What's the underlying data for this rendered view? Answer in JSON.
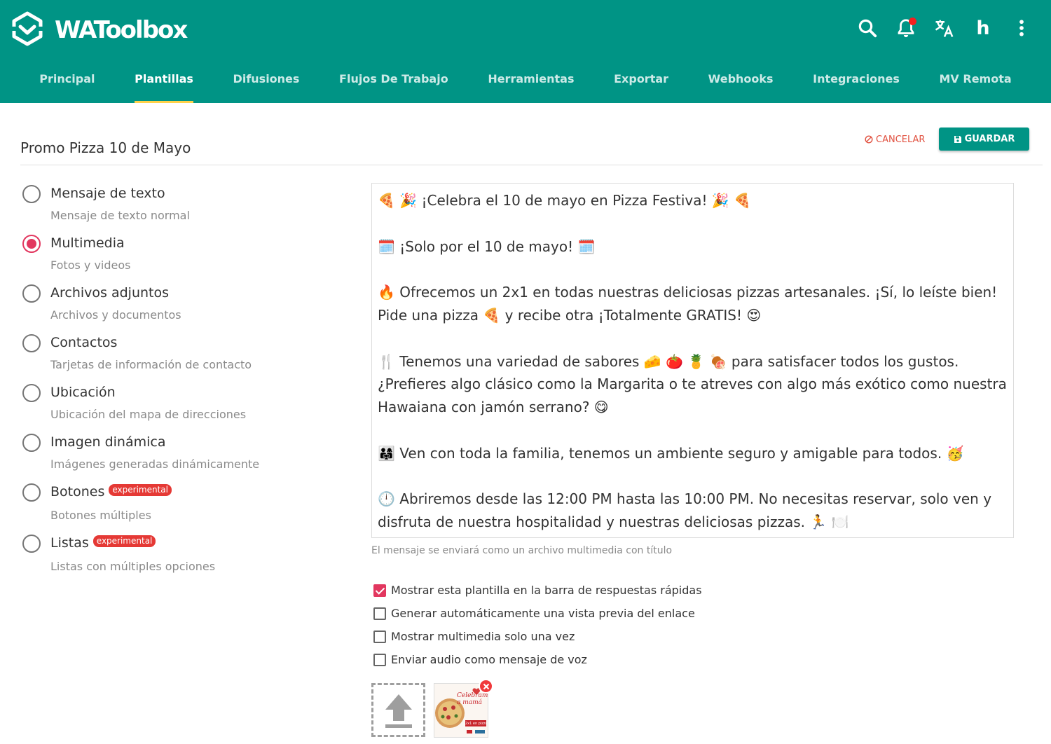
{
  "app": {
    "name": "WAToolbox",
    "icons": [
      "logo-icon",
      "search-icon",
      "notification-bell-icon",
      "translate-icon",
      "user-avatar",
      "more-vert-icon"
    ],
    "avatar_letter": "h",
    "colors": {
      "primary": "#009485",
      "accent_tab": "#ffd24a",
      "selection": "#e2375f",
      "danger": "#e15241",
      "badge": "#e53935"
    }
  },
  "nav": {
    "tabs": [
      {
        "label": "Principal"
      },
      {
        "label": "Plantillas"
      },
      {
        "label": "Difusiones"
      },
      {
        "label": "Flujos De Trabajo"
      },
      {
        "label": "Herramientas"
      },
      {
        "label": "Exportar"
      },
      {
        "label": "Webhooks"
      },
      {
        "label": "Integraciones"
      },
      {
        "label": "MV Remota"
      }
    ],
    "active": "Plantillas"
  },
  "template": {
    "title": "Promo Pizza 10 de Mayo",
    "cancel_label": "CANCELAR",
    "save_label": "GUARDAR"
  },
  "options": [
    {
      "label": "Mensaje de texto",
      "description": "Mensaje de texto normal",
      "selected": false
    },
    {
      "label": "Multimedia",
      "description": "Fotos y videos",
      "selected": true
    },
    {
      "label": "Archivos adjuntos",
      "description": "Archivos y documentos",
      "selected": false
    },
    {
      "label": "Contactos",
      "description": "Tarjetas de información de contacto",
      "selected": false
    },
    {
      "label": "Ubicación",
      "description": "Ubicación del mapa de direcciones",
      "selected": false
    },
    {
      "label": "Imagen dinámica",
      "description": "Imágenes generadas dinámicamente",
      "selected": false
    },
    {
      "label": "Botones",
      "badge": "experimental",
      "description": "Botones múltiples",
      "selected": false
    },
    {
      "label": "Listas",
      "badge": "experimental",
      "description": "Listas con múltiples opciones",
      "selected": false
    }
  ],
  "message": {
    "lines": [
      "🍕 🎉 ¡Celebra el 10 de mayo en Pizza Festiva! 🎉 🍕",
      "",
      "🗓️ ¡Solo por el 10 de mayo! 🗓️",
      "",
      "🔥 Ofrecemos un 2x1 en todas nuestras deliciosas pizzas artesanales. ¡Sí, lo leíste bien!",
      "Pide una pizza 🍕 y recibe otra ¡Totalmente GRATIS! 😍",
      "",
      "🍴 Tenemos una variedad de sabores 🧀 🍅 🍍 🍖 para satisfacer todos los gustos.",
      "¿Prefieres algo clásico como la Margarita o te atreves con algo más exótico como nuestra",
      "Hawaiana con jamón serrano? 😋",
      "",
      "👨‍👩‍👧 Ven con toda la familia, tenemos un ambiente seguro y amigable para todos. 🥳",
      "",
      "🕛 Abriremos desde las 12:00 PM hasta las 10:00 PM. No necesitas reservar, solo ven y",
      "disfruta de nuestra hospitalidad y nuestras deliciosas pizzas. 🏃 🍽️"
    ],
    "help_text": "El mensaje se enviará como un archivo multimedia con título"
  },
  "checkboxes": [
    {
      "label": "Mostrar esta plantilla en la barra de respuestas rápidas",
      "checked": true
    },
    {
      "label": "Generar automáticamente una vista previa del enlace",
      "checked": false
    },
    {
      "label": "Mostrar multimedia solo una vez",
      "checked": false
    },
    {
      "label": "Enviar audio como mensaje de voz",
      "checked": false
    }
  ],
  "media": {
    "upload_icon": "upload-icon",
    "thumbnail_icon": "pizza-promo-image",
    "remove_icon": "close-icon",
    "thumbnail_text": [
      "Celebramos",
      "a mamá",
      "2x1 en pizzas"
    ]
  }
}
